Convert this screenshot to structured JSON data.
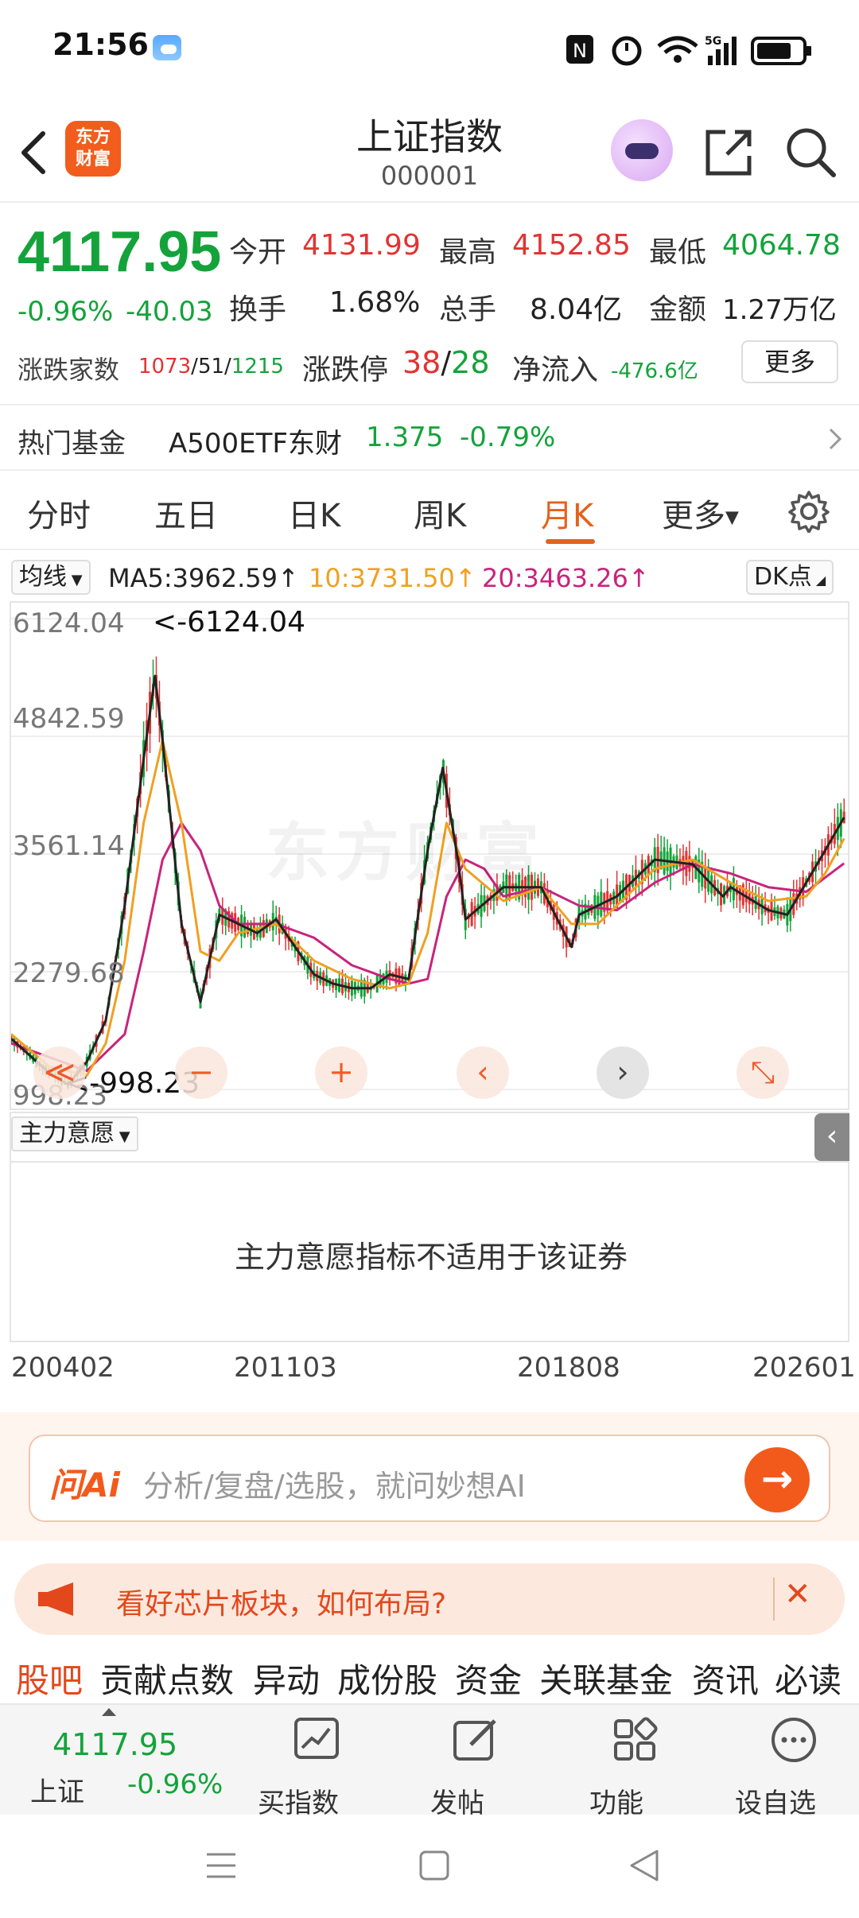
{
  "status_bar": {
    "time": "21:56",
    "network": "5G"
  },
  "header": {
    "logo_line1": "东方",
    "logo_line2": "财富",
    "title": "上证指数",
    "code": "000001"
  },
  "quote": {
    "price": "4117.95",
    "change_pct": "-0.96%",
    "change": "-40.03",
    "open_label": "今开",
    "open": "4131.99",
    "high_label": "最高",
    "high": "4152.85",
    "low_label": "最低",
    "low": "4064.78",
    "turnover_label": "换手",
    "turnover": "1.68%",
    "volume_label": "总手",
    "volume": "8.04亿",
    "amount_label": "金额",
    "amount": "1.27万亿",
    "breadth_label": "涨跌家数",
    "breadth_up": "1073",
    "breadth_flat": "51",
    "breadth_down": "1215",
    "slash": "/",
    "limit_label": "涨跌停",
    "limit_up": "38",
    "limit_down": "28",
    "netflow_label": "净流入",
    "netflow": "-476.6亿",
    "more": "更多"
  },
  "hot_fund": {
    "label": "热门基金",
    "name": "A500ETF东财",
    "price": "1.375",
    "change": "-0.79%"
  },
  "tabs": [
    {
      "label": "分时"
    },
    {
      "label": "五日"
    },
    {
      "label": "日K"
    },
    {
      "label": "周K"
    },
    {
      "label": "月K",
      "active": true
    },
    {
      "label": "更多"
    }
  ],
  "ma": {
    "selector": "均线",
    "ma5": "MA5:3962.59",
    "ma10": "10:3731.50",
    "ma20": "20:3463.26",
    "arrow": "↑",
    "dk": "DK点",
    "colors": {
      "ma5": "#222222",
      "ma10": "#f0a020",
      "ma20": "#c8247c"
    }
  },
  "chart_data": {
    "type": "line",
    "y_tick_labels": [
      "6124.04",
      "4842.59",
      "3561.14",
      "2279.68",
      "998.23"
    ],
    "annotations": [
      "<-6124.04",
      "<-998.23"
    ],
    "x_tick_labels": [
      "200402",
      "201103",
      "201808",
      "202601"
    ],
    "ylim": [
      998.23,
      6124.04
    ],
    "watermark": "东方财富",
    "series": [
      {
        "name": "MA5",
        "color": "#222222",
        "x": [
          2004,
          2005,
          2005.5,
          2006,
          2006.5,
          2007,
          2007.5,
          2007.8,
          2008,
          2008.5,
          2009,
          2009.5,
          2010,
          2010.5,
          2011,
          2011.5,
          2012,
          2012.5,
          2013,
          2013.5,
          2014,
          2014.5,
          2015,
          2015.4,
          2015.8,
          2016,
          2017,
          2018,
          2018.8,
          2019,
          2020,
          2021,
          2022,
          2022.8,
          2023,
          2024,
          2024.5,
          2025,
          2025.5,
          2026
        ],
        "values": [
          1550,
          1180,
          1050,
          1300,
          1750,
          3000,
          4600,
          5500,
          4800,
          2800,
          1950,
          2900,
          2800,
          2700,
          2850,
          2550,
          2250,
          2150,
          2100,
          2100,
          2250,
          2200,
          3600,
          4500,
          3500,
          2850,
          3200,
          3200,
          2550,
          2900,
          3100,
          3500,
          3450,
          3100,
          3200,
          2950,
          2900,
          3250,
          3600,
          3960
        ]
      },
      {
        "name": "10",
        "color": "#f0a020",
        "x": [
          2004,
          2005,
          2006,
          2006.5,
          2007,
          2007.5,
          2008,
          2008.5,
          2009,
          2009.5,
          2010,
          2011,
          2012,
          2013,
          2014,
          2014.5,
          2015,
          2015.5,
          2016,
          2017,
          2018,
          2018.8,
          2019.5,
          2020,
          2021,
          2022,
          2023,
          2024,
          2025,
          2025.5,
          2026
        ],
        "values": [
          1600,
          1250,
          1150,
          1500,
          2400,
          3900,
          4800,
          3900,
          2500,
          2400,
          2700,
          2800,
          2400,
          2200,
          2100,
          2150,
          2700,
          3900,
          3400,
          3050,
          3200,
          2800,
          2800,
          3000,
          3400,
          3500,
          3250,
          3050,
          3100,
          3350,
          3730
        ]
      },
      {
        "name": "20",
        "color": "#c8247c",
        "x": [
          2004,
          2005,
          2006,
          2007,
          2007.5,
          2008,
          2008.5,
          2009,
          2009.5,
          2010,
          2011,
          2012,
          2013,
          2014,
          2014.5,
          2015,
          2015.5,
          2016,
          2016.5,
          2017,
          2018,
          2019,
          2020,
          2021,
          2022,
          2023,
          2024,
          2025,
          2026
        ],
        "values": [
          1500,
          1350,
          1200,
          1600,
          2500,
          3500,
          3900,
          3600,
          3000,
          2800,
          2800,
          2650,
          2350,
          2200,
          2150,
          2200,
          3100,
          3500,
          3400,
          3100,
          3200,
          3000,
          2950,
          3250,
          3450,
          3350,
          3200,
          3150,
          3460
        ]
      }
    ]
  },
  "chart_controls": [
    "≪",
    "−",
    "+",
    "‹",
    "›",
    "⤡"
  ],
  "indicator": {
    "selector": "主力意愿",
    "message": "主力意愿指标不适用于该证券"
  },
  "ai": {
    "brand": "问Ai",
    "placeholder": "分析/复盘/选股，就问妙想AI",
    "go": "→"
  },
  "promo": {
    "text": "看好芯片板块，如何布局?",
    "close": "✕"
  },
  "bottom_tabs": [
    "股吧",
    "贡献点数",
    "异动",
    "成份股",
    "资金",
    "关联基金",
    "资讯",
    "必读"
  ],
  "dock": {
    "price": "4117.95",
    "name": "上证",
    "change": "-0.96%",
    "items": [
      {
        "label": "买指数"
      },
      {
        "label": "发帖"
      },
      {
        "label": "功能"
      },
      {
        "label": "设自选"
      }
    ]
  }
}
